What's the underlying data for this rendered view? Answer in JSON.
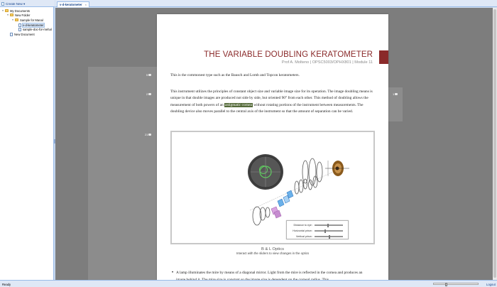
{
  "toolbar": {
    "create_new_label": "Create New ▾"
  },
  "tree": [
    {
      "label": "My Documents",
      "expander": "▾",
      "icon": "folder"
    },
    {
      "label": "New Folder",
      "expander": "▾",
      "icon": "folder"
    },
    {
      "label": "Sample for Manal",
      "expander": "▾",
      "icon": "folder"
    },
    {
      "label": "v-d-keratometer",
      "expander": "",
      "icon": "file",
      "selected": true
    },
    {
      "label": "sample-doc-for-mehal",
      "expander": "",
      "icon": "file"
    },
    {
      "label": "New Document",
      "expander": "",
      "icon": "file"
    }
  ],
  "tab": {
    "label": "v-d-keratometer",
    "close": "×"
  },
  "comments": {
    "a": "5",
    "b": "2",
    "c": "21",
    "d": "1"
  },
  "page": {
    "title": "THE VARIABLE DOUBLING KERATOMETER",
    "subtitle": "Prof A. Molteno | OPSC5003/OPHX801 | Module 11",
    "para1": "This is the commonest type such as the Bausch and Lomb and Topcon keratometers.",
    "para2_before": "This instrument utilizes the principles of constant object size and variable image size for its operation. The image doubling means is unique in that double images are produced not side by side, but oriented 90° from each other. This method of doubling allows the measurement of both powers of an ",
    "para2_highlight": "astigmatic cornea",
    "para2_after": " without rotating portions of the instrument between measurements. The doubling device also moves parallel to the central axis of the instrument so that the amount of separation can be varied.",
    "figure_title": "B & L Optics",
    "figure_caption": "Interact with the sliders to view changes in the optics",
    "bullet": "A lamp illuminates the mire by means of a diagonal mirror. Light from the mire is reflected in the cornea and produces an image behind it. The mire size is constant so the image size is dependent on the corneal radius. This"
  },
  "sliders": [
    {
      "label": "Distance to eye :",
      "position": 0.45
    },
    {
      "label": "Horizontal prism :",
      "position": 0.35
    },
    {
      "label": "Vertical prism :",
      "position": 0.5
    }
  ],
  "status": {
    "text": "Ready",
    "logout": "Logout",
    "zoom_position": 0.25
  },
  "colors": {
    "title": "#8a2a2a",
    "highlight": "#556b3a",
    "toolbar_bg": "#dfe8f6",
    "workspace": "#7d7d7d"
  }
}
